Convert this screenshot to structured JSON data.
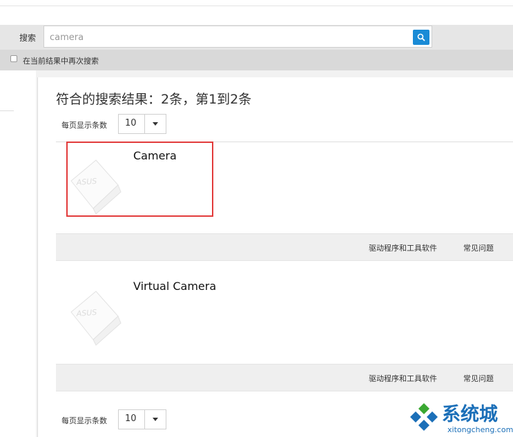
{
  "search": {
    "label": "搜索",
    "value": "camera",
    "research_label": "在当前结果中再次搜索"
  },
  "results": {
    "summary": "符合的搜索结果：2条，第1到2条",
    "perpage_label": "每页显示条数",
    "perpage_value": "10",
    "items": [
      {
        "name": "Camera",
        "links": {
          "drivers": "驱动程序和工具软件",
          "faq": "常见问题"
        }
      },
      {
        "name": "Virtual Camera",
        "links": {
          "drivers": "驱动程序和工具软件",
          "faq": "常见问题"
        }
      }
    ]
  },
  "watermark": {
    "text": "系统城",
    "sub": "xitongcheng.com"
  },
  "colors": {
    "search_button": "#1a8bd6",
    "highlight": "#e23a3a",
    "watermark": "#1b6fb8"
  }
}
